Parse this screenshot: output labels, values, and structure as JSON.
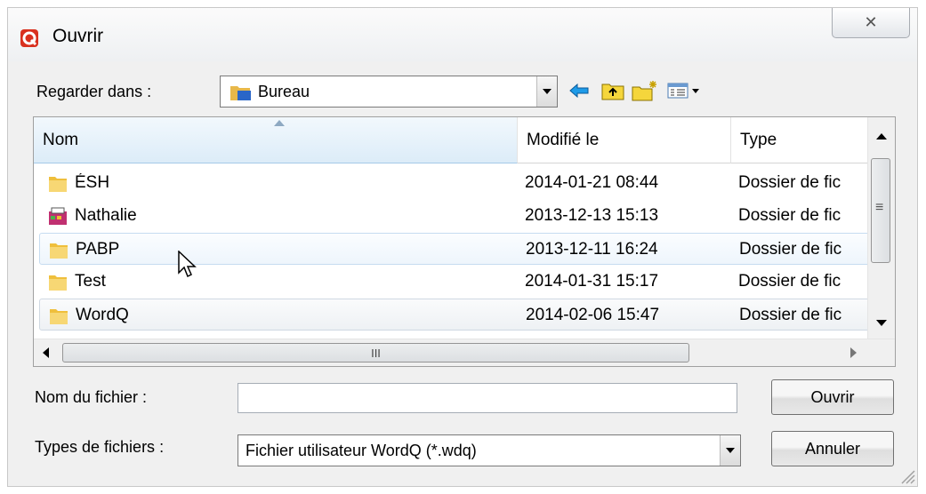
{
  "window": {
    "title": "Ouvrir",
    "app_icon": "wordq-icon",
    "close_symbol": "✕"
  },
  "look_in": {
    "label": "Regarder dans :",
    "value": "Bureau"
  },
  "toolbar": {
    "back_icon": "arrow-left-icon",
    "up_icon": "folder-up-icon",
    "new_folder_icon": "new-folder-icon",
    "view_menu_icon": "view-menu-icon"
  },
  "file_list": {
    "columns": [
      "Nom",
      "Modifié le",
      "Type"
    ],
    "rows": [
      {
        "name": "ÉSH",
        "modified": "2014-01-21 08:44",
        "type": "Dossier de fic"
      },
      {
        "name": "Nathalie",
        "modified": "2013-12-13 15:13",
        "type": "Dossier de fic"
      },
      {
        "name": "PABP",
        "modified": "2013-12-11 16:24",
        "type": "Dossier de fic"
      },
      {
        "name": "Test",
        "modified": "2014-01-31 15:17",
        "type": "Dossier de fic"
      },
      {
        "name": "WordQ",
        "modified": "2014-02-06 15:47",
        "type": "Dossier de fic"
      }
    ],
    "hscroll_grip": "III",
    "vscroll_grip": "≡"
  },
  "filename": {
    "label": "Nom du fichier :",
    "value": ""
  },
  "filetype": {
    "label": "Types de fichiers :",
    "value": "Fichier utilisateur WordQ (*.wdq)"
  },
  "buttons": {
    "open": "Ouvrir",
    "cancel": "Annuler"
  },
  "colors": {
    "folder": "#f0c040",
    "selection_border": "#c6dcf0",
    "toolbar_icon": "#d4a800"
  }
}
